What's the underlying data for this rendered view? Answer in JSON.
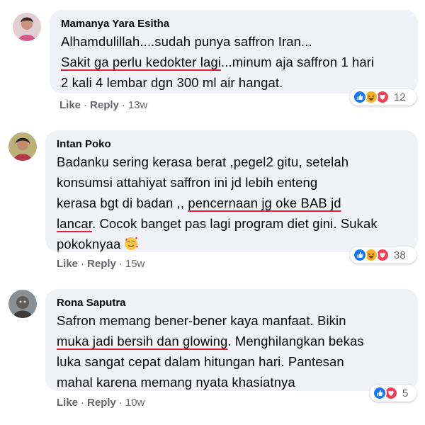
{
  "comments": [
    {
      "author": "Mamanya Yara Esitha",
      "lines": [
        {
          "parts": [
            {
              "text": "Alhamdulillah....sudah punya saffron Iran...",
              "u": false
            }
          ]
        },
        {
          "parts": [
            {
              "text": "Sakit ga perlu kedokter lagi",
              "u": true
            },
            {
              "text": "...minum aja saffron 1 hari",
              "u": false
            }
          ]
        },
        {
          "parts": [
            {
              "text": "2 kali 4 lembar dgn 300 ml air hangat.",
              "u": false
            }
          ]
        }
      ],
      "reactions": [
        "like",
        "haha",
        "love"
      ],
      "reaction_count": "12",
      "like_label": "Like",
      "reply_label": "Reply",
      "time": "13w"
    },
    {
      "author": "Intan Poko",
      "lines": [
        {
          "parts": [
            {
              "text": "Badanku sering kerasa berat ,pegel2 gitu, setelah",
              "u": false
            }
          ]
        },
        {
          "parts": [
            {
              "text": "konsumsi attahiyat saffron ini jd lebih enteng",
              "u": false
            }
          ]
        },
        {
          "parts": [
            {
              "text": "kerasa bgt di badan ,, ",
              "u": false
            },
            {
              "text": "pencernaan jg oke BAB jd",
              "u": true
            }
          ]
        },
        {
          "parts": [
            {
              "text": "lancar",
              "u": true
            },
            {
              "text": ". Cocok banget pas lagi program diet gini. Sukak",
              "u": false
            }
          ]
        },
        {
          "parts": [
            {
              "text": "pokoknyaa",
              "u": false
            }
          ]
        }
      ],
      "inline_emoji": "smiling-face-with-hearts",
      "reactions": [
        "like",
        "haha",
        "love"
      ],
      "reaction_count": "38",
      "like_label": "Like",
      "reply_label": "Reply",
      "time": "15w"
    },
    {
      "author": "Rona Saputra",
      "lines": [
        {
          "parts": [
            {
              "text": "Safron memang bener-bener kaya manfaat. Bikin",
              "u": false
            }
          ]
        },
        {
          "parts": [
            {
              "text": "muka jadi bersih dan glowing",
              "u": true
            },
            {
              "text": ". Menghilangkan bekas",
              "u": false
            }
          ]
        },
        {
          "parts": [
            {
              "text": "luka sangat cepat dalam hitungan hari. Pantesan",
              "u": false
            }
          ]
        },
        {
          "parts": [
            {
              "text": "mahal karena memang nyata khasiatnya",
              "u": false
            }
          ]
        }
      ],
      "reactions": [
        "like",
        "love"
      ],
      "reaction_count": "5",
      "like_label": "Like",
      "reply_label": "Reply",
      "time": "10w"
    }
  ],
  "colors": {
    "bubble": "#f0f2f5",
    "underline": "#d7263d",
    "like_blue": "#1877f2",
    "love_red": "#f33e58",
    "haha_yellow": "#f7b125",
    "meta_gray": "#65676b"
  }
}
